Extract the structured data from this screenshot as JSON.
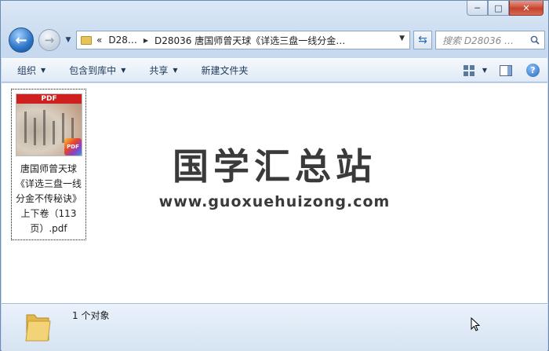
{
  "window": {
    "caption": {
      "minimize": "─",
      "maximize": "□",
      "close": "✕"
    }
  },
  "nav": {
    "back_glyph": "←",
    "forward_glyph": "→",
    "breadcrumb": [
      "«",
      "D28…",
      "D28036 唐国师曾天球《详选三盘一线分金…"
    ],
    "search_placeholder": "搜索 D28036 …"
  },
  "toolbar": {
    "items": [
      {
        "label": "组织",
        "has_dropdown": true
      },
      {
        "label": "包含到库中",
        "has_dropdown": true
      },
      {
        "label": "共享",
        "has_dropdown": true
      },
      {
        "label": "新建文件夹",
        "has_dropdown": false
      }
    ],
    "help": "?"
  },
  "files": [
    {
      "name": "唐国师曾天球《详选三盘一线分金不传秘诀》上下卷（113页）.pdf",
      "thumb_band": "PDF",
      "badge": "PDF"
    }
  ],
  "watermark": {
    "title": "国学汇总站",
    "url": "www.guoxuehuizong.com"
  },
  "status": {
    "text": "1 个对象"
  }
}
